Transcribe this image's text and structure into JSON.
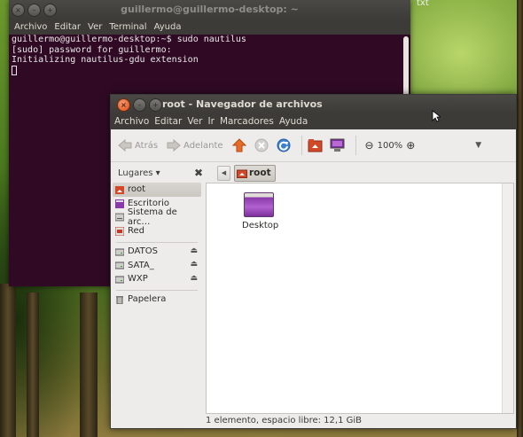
{
  "desktop": {
    "label": "txt"
  },
  "terminal": {
    "title": "guillermo@guillermo-desktop: ~",
    "buttons": {
      "close": "×",
      "minimize": "–",
      "maximize": "+"
    },
    "menu": [
      "Archivo",
      "Editar",
      "Ver",
      "Terminal",
      "Ayuda"
    ],
    "lines": [
      "guillermo@guillermo-desktop:~$ sudo nautilus",
      "[sudo] password for guillermo:",
      "Initializing nautilus-gdu extension"
    ]
  },
  "nautilus": {
    "title": "root - Navegador de archivos",
    "buttons": {
      "close": "×",
      "minimize": "–",
      "maximize": "+"
    },
    "menu": [
      "Archivo",
      "Editar",
      "Ver",
      "Ir",
      "Marcadores",
      "Ayuda"
    ],
    "toolbar": {
      "back_label": "Atrás",
      "forward_label": "Adelante",
      "zoom_level": "100%"
    },
    "sidebar_header": "Lugares ▾",
    "path": {
      "current": "root"
    },
    "places": [
      {
        "label": "root",
        "icon": "home-folder-icon",
        "selected": true
      },
      {
        "label": "Escritorio",
        "icon": "desktop-icon"
      },
      {
        "label": "Sistema de arc…",
        "icon": "filesystem-icon"
      },
      {
        "label": "Red",
        "icon": "network-icon"
      }
    ],
    "devices": [
      {
        "label": "DATOS",
        "icon": "drive-icon",
        "eject": "⏏"
      },
      {
        "label": "SATA_",
        "icon": "drive-icon",
        "eject": "⏏"
      },
      {
        "label": "WXP",
        "icon": "drive-icon",
        "eject": "⏏"
      }
    ],
    "other": [
      {
        "label": "Papelera",
        "icon": "trash-icon"
      }
    ],
    "files": [
      {
        "name": "Desktop",
        "icon": "folder-desktop-icon"
      }
    ],
    "status": "1 elemento, espacio libre: 12,1 GiB",
    "colors": {
      "accent": "#dd4814",
      "titlebar": "#3c3b37",
      "window_bg": "#edeceb",
      "terminal_bg": "#300a24"
    }
  }
}
